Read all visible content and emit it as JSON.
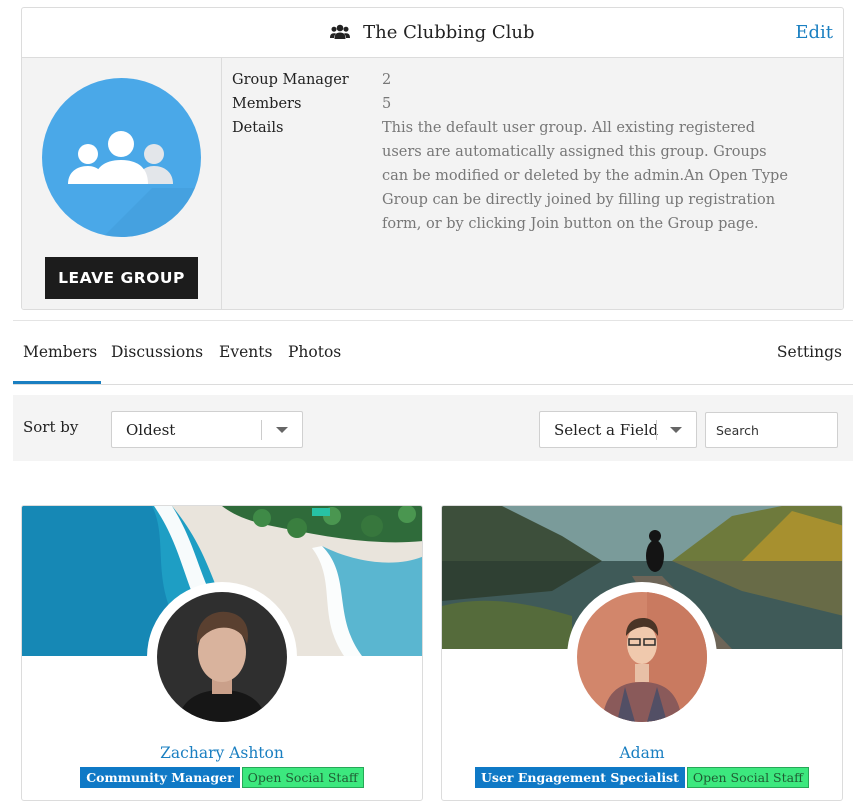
{
  "group": {
    "title": "The Clubbing Club",
    "edit_label": "Edit",
    "leave_label": "LEAVE GROUP",
    "icon": "users-icon",
    "info": [
      {
        "key": "Group Manager",
        "value": "2"
      },
      {
        "key": "Members",
        "value": "5"
      },
      {
        "key": "Details",
        "value": "This the default user group. All existing registered users are automatically assigned this group. Groups can be modified or deleted by the admin.An Open Type Group can be directly joined by filling up registration form, or by clicking Join button on the Group page."
      }
    ]
  },
  "tabs": {
    "members": "Members",
    "discussions": "Discussions",
    "events": "Events",
    "photos": "Photos",
    "settings": "Settings",
    "active": "Members"
  },
  "filters": {
    "sort_label": "Sort by",
    "sort_value": "Oldest",
    "field_value": "Select a Field",
    "search_placeholder": "Search"
  },
  "members": [
    {
      "name": "Zachary Ashton",
      "role": "Community Manager",
      "tag": "Open Social Staff"
    },
    {
      "name": "Adam",
      "role": "User Engagement Specialist",
      "tag": "Open Social Staff"
    }
  ],
  "colors": {
    "accent": "#1a7fc1",
    "avatar_bg": "#4aa8e8",
    "role_badge": "#0f79c6",
    "staff_badge": "#3ce87e"
  }
}
